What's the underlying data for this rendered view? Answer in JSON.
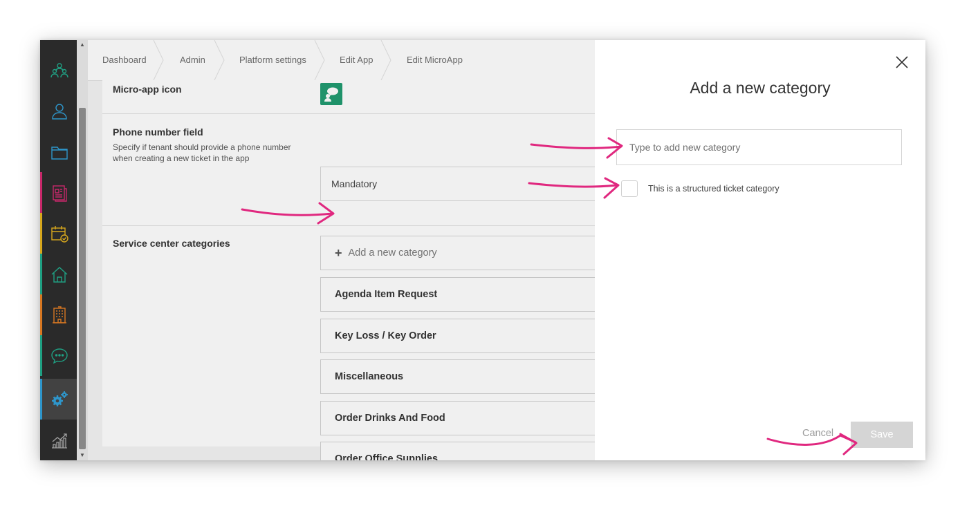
{
  "breadcrumb": [
    "Dashboard",
    "Admin",
    "Platform settings",
    "Edit App",
    "Edit MicroApp"
  ],
  "sidebar": {
    "items": [
      {
        "icon": "people-icon",
        "color": "#1fa98a"
      },
      {
        "icon": "person-icon",
        "color": "#2f9fd8"
      },
      {
        "icon": "folder-icon",
        "color": "#2f9fd8"
      },
      {
        "icon": "document-icon",
        "color": "#d4286f"
      },
      {
        "icon": "calendar-check-icon",
        "color": "#e6b21c"
      },
      {
        "icon": "home-icon",
        "color": "#1fa98a"
      },
      {
        "icon": "building-icon",
        "color": "#e67e22"
      },
      {
        "icon": "chat-icon",
        "color": "#1fa98a"
      },
      {
        "icon": "gears-icon",
        "color": "#2f9fd8"
      },
      {
        "icon": "chart-icon",
        "color": "#aaaaaa"
      }
    ]
  },
  "form": {
    "micro_app_icon_label": "Micro-app icon",
    "phone_label": "Phone number field",
    "phone_desc": "Specify if tenant should provide a phone number when creating a new ticket in the app",
    "phone_value": "Mandatory",
    "categories_label": "Service center categories",
    "add_category": "Add a new category",
    "categories": [
      "Agenda Item Request",
      "Key Loss / Key Order",
      "Miscellaneous",
      "Order Drinks And Food",
      "Order Office Supplies"
    ]
  },
  "modal": {
    "title": "Add a new category",
    "input_placeholder": "Type to add new category",
    "checkbox_label": "This is a structured ticket category",
    "cancel_label": "Cancel",
    "save_label": "Save"
  },
  "colors": {
    "accent_arrow": "#e0287f",
    "app_icon_bg": "#1f9a6f",
    "sidebar_bg": "#2b2b2b",
    "save_disabled_bg": "#d5d5d5"
  }
}
